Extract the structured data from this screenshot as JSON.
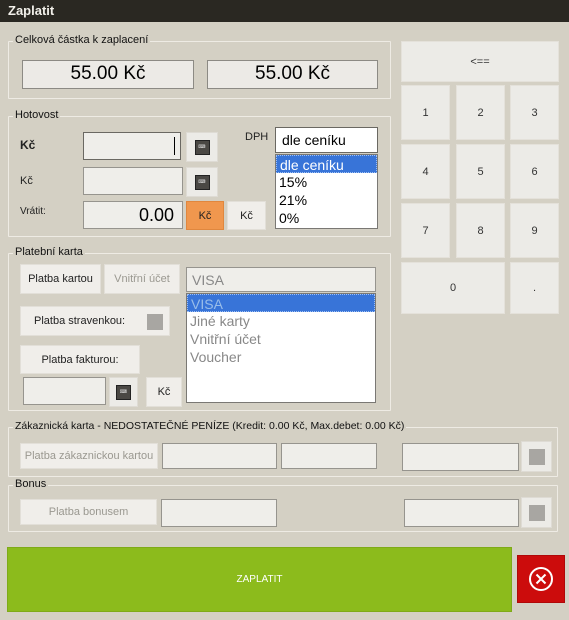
{
  "window": {
    "title": "Zaplatit"
  },
  "total": {
    "legend": "Celková částka k zaplacení",
    "amount_left": "55.00 Kč",
    "amount_right": "55.00 Kč"
  },
  "cash": {
    "legend": "Hotovost",
    "kc_label": "Kč",
    "kc2_label": "Kč",
    "return_label": "Vrátit:",
    "return_value": "0.00",
    "kc_button": "Kč",
    "kc_button2": "Kč",
    "vat_label": "DPH",
    "vat_selected": "dle ceníku",
    "vat_options": [
      "dle ceníku",
      "15%",
      "21%",
      "0%"
    ]
  },
  "card": {
    "legend": "Platební karta",
    "pay_card": "Platba kartou",
    "internal_account": "Vnitřní účet",
    "card_type_value": "VISA",
    "card_types": [
      "VISA",
      "Jiné karty",
      "Vnitřní účet",
      "Voucher"
    ],
    "meal_voucher": "Platba stravenkou:",
    "invoice": "Platba fakturou:",
    "kc_button": "Kč"
  },
  "customer": {
    "legend": "Zákaznická karta  -  NEDOSTATEČNÉ PENÍZE (Kredit: 0.00 Kč, Max.debet: 0.00 Kč)",
    "pay_customer": "Platba zákaznickou kartou"
  },
  "bonus": {
    "legend": "Bonus",
    "pay_bonus": "Platba bonusem"
  },
  "keypad": {
    "backspace": "<==",
    "keys": [
      "1",
      "2",
      "3",
      "4",
      "5",
      "6",
      "7",
      "8",
      "9",
      "0",
      "."
    ]
  },
  "actions": {
    "pay": "ZAPLATIT"
  },
  "colors": {
    "pay_green": "#8cbb1c",
    "cancel_red": "#cc0c0c",
    "accent_orange": "#f0974e",
    "selection_blue": "#3874d8"
  }
}
